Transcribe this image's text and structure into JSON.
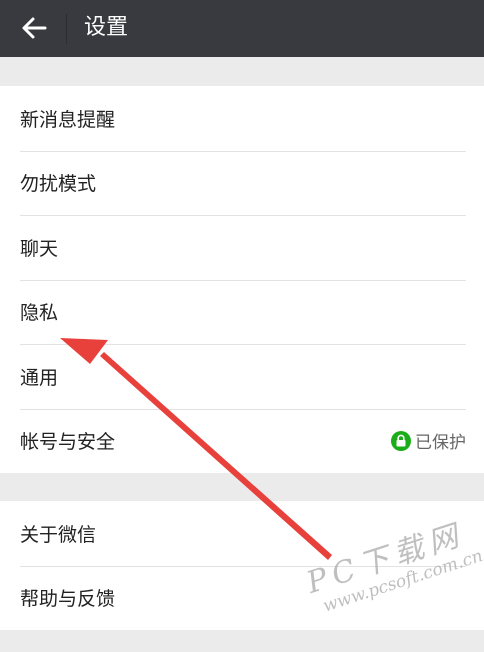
{
  "header": {
    "title": "设置",
    "back_icon": "arrow-left-icon"
  },
  "groups": [
    {
      "items": [
        {
          "label": "新消息提醒"
        },
        {
          "label": "勿扰模式"
        },
        {
          "label": "聊天"
        },
        {
          "label": "隐私"
        },
        {
          "label": "通用"
        },
        {
          "label": "帐号与安全",
          "status": "已保护",
          "status_icon": "lock-icon"
        }
      ]
    },
    {
      "items": [
        {
          "label": "关于微信"
        },
        {
          "label": "帮助与反馈"
        }
      ]
    }
  ],
  "annotation": {
    "type": "red-arrow",
    "target": "隐私",
    "color": "#e8403a"
  },
  "watermark": {
    "main": "PC下载网",
    "url": "www.pcsoft.com.cn"
  },
  "colors": {
    "header_bg": "#393a3f",
    "page_bg": "#ebebeb",
    "secure_green": "#1aad19"
  }
}
